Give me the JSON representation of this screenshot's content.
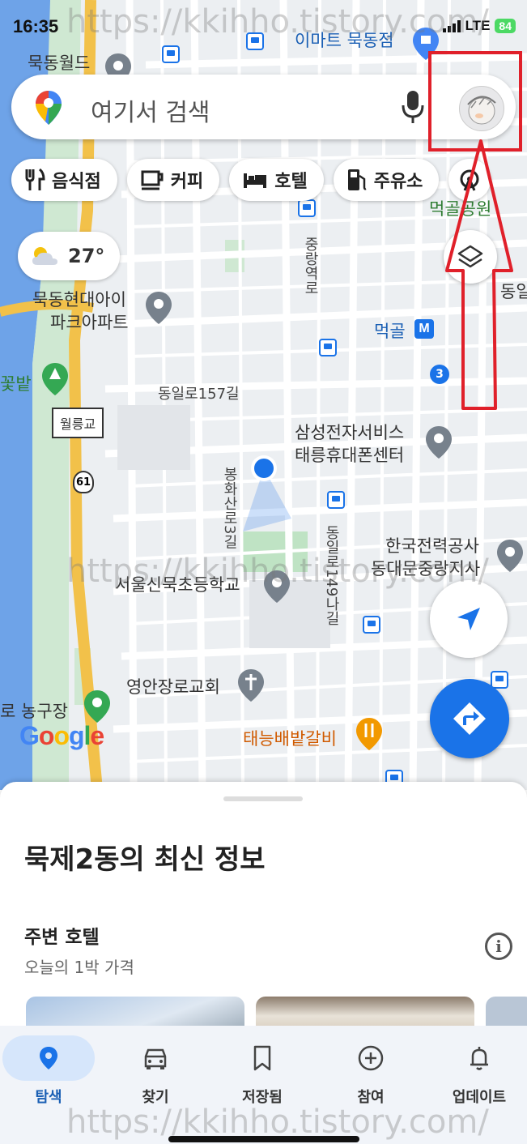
{
  "status_bar": {
    "time": "16:35",
    "network": "LTE",
    "battery": "84"
  },
  "search": {
    "placeholder": "여기서 검색"
  },
  "chips": [
    "음식점",
    "커피",
    "호텔",
    "주유소"
  ],
  "weather": {
    "temp": "27°"
  },
  "map_labels": {
    "emart": "이마트 묵동점",
    "mukdong_world": "묵동월드",
    "park": "먹골공원",
    "jungnangyeokro": "중랑역로",
    "hyundai": "묵동현대아이",
    "park_apt": "파크아파트",
    "meokgol": "먹골",
    "metro_m": "M",
    "route3": "3",
    "kkotbat": "꽃밭",
    "dongil157": "동일로157길",
    "samsung1": "삼성전자서비스",
    "samsung2": "태릉휴대폰센터",
    "wolleunggyo": "월릉교",
    "route61": "61",
    "bonghwasan": "봉화산로3길",
    "kepco1": "한국전력공사",
    "kepco2": "동대문중랑지사",
    "dongil149": "동일로149나길",
    "school": "서울신묵초등학교",
    "church": "영안장로교회",
    "basketball": "로 농구장",
    "galbi": "태능배밭갈비",
    "dongil_right": "동일",
    "google": "Google"
  },
  "sheet": {
    "title": "묵제2동의 최신 정보",
    "section_title": "주변 호텔",
    "section_sub": "오늘의 1박 가격"
  },
  "nav": [
    {
      "label": "탐색",
      "icon": "explore-pin-icon",
      "active": true
    },
    {
      "label": "찾기",
      "icon": "car-icon"
    },
    {
      "label": "저장됨",
      "icon": "bookmark-icon"
    },
    {
      "label": "참여",
      "icon": "add-circle-icon"
    },
    {
      "label": "업데이트",
      "icon": "bell-icon"
    }
  ],
  "watermark": "https://kkihho.tistory.com/",
  "colors": {
    "accent": "#1a73e8",
    "annotation": "#e0202a"
  }
}
